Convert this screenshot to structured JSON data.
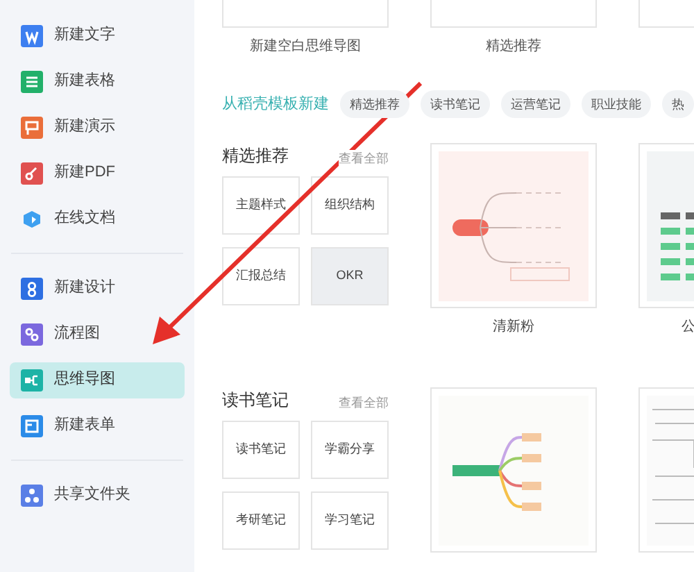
{
  "sidebar": {
    "groups": [
      {
        "items": [
          {
            "label": "新建文字",
            "kind": "word",
            "selected": false
          },
          {
            "label": "新建表格",
            "kind": "sheet",
            "selected": false
          },
          {
            "label": "新建演示",
            "kind": "slides",
            "selected": false
          },
          {
            "label": "新建PDF",
            "kind": "pdf",
            "selected": false
          },
          {
            "label": "在线文档",
            "kind": "cloud",
            "selected": false
          }
        ]
      },
      {
        "items": [
          {
            "label": "新建设计",
            "kind": "design",
            "selected": false
          },
          {
            "label": "流程图",
            "kind": "flow",
            "selected": false
          },
          {
            "label": "思维导图",
            "kind": "mindmap",
            "selected": true
          },
          {
            "label": "新建表单",
            "kind": "form",
            "selected": false
          }
        ]
      },
      {
        "items": [
          {
            "label": "共享文件夹",
            "kind": "share",
            "selected": false
          }
        ]
      }
    ]
  },
  "top_cards": [
    {
      "label": "新建空白思维导图"
    },
    {
      "label": "精选推荐"
    }
  ],
  "template_source": {
    "title": "从稻壳模板新建",
    "chips": [
      "精选推荐",
      "读书笔记",
      "运营笔记",
      "职业技能",
      "热"
    ]
  },
  "sections": [
    {
      "title": "精选推荐",
      "view_all": "查看全部",
      "tiles": [
        {
          "label": "主题样式",
          "shaded": false
        },
        {
          "label": "组织结构",
          "shaded": false
        },
        {
          "label": "汇报总结",
          "shaded": false
        },
        {
          "label": "OKR",
          "shaded": true
        }
      ],
      "templates": [
        {
          "kind": "pink",
          "label": "清新粉"
        },
        {
          "kind": "green",
          "label": "公"
        }
      ]
    },
    {
      "title": "读书笔记",
      "view_all": "查看全部",
      "tiles": [
        {
          "label": "读书笔记",
          "shaded": false
        },
        {
          "label": "学霸分享",
          "shaded": false
        },
        {
          "label": "考研笔记",
          "shaded": false
        },
        {
          "label": "学习笔记",
          "shaded": false
        }
      ],
      "templates": [
        {
          "kind": "colorful"
        },
        {
          "kind": "sketch"
        }
      ]
    }
  ]
}
